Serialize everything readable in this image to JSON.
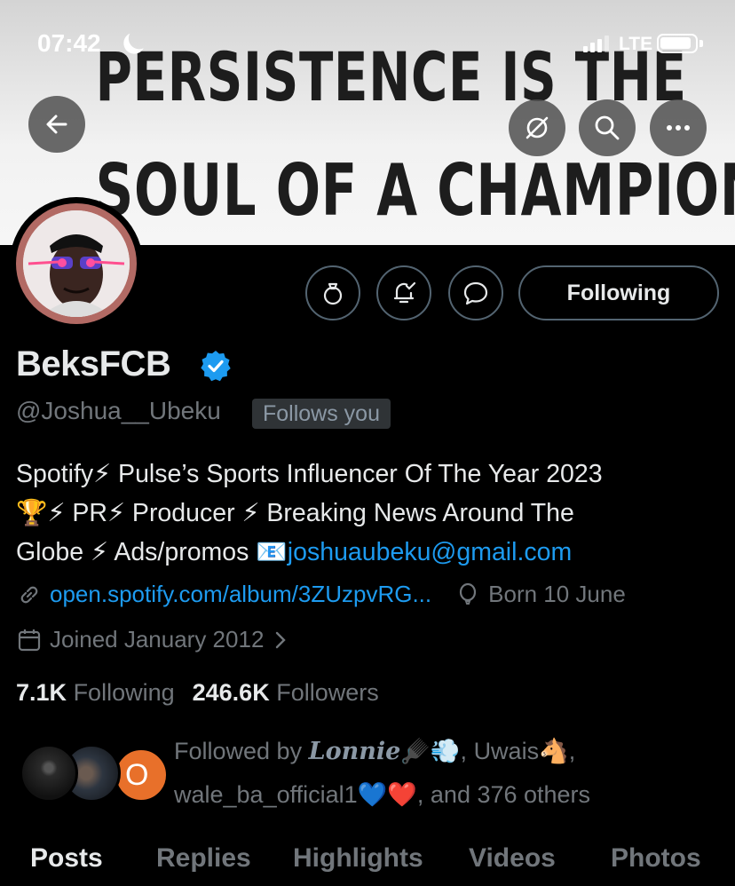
{
  "status_bar": {
    "time": "07:42",
    "network": "LTE"
  },
  "banner": {
    "line1": "PERSISTENCE IS THE",
    "line2": "SOUL OF A CHAMPION"
  },
  "header_icons": [
    "back-arrow-icon",
    "grok-icon",
    "search-icon",
    "more-icon"
  ],
  "actions": {
    "following_label": "Following"
  },
  "profile": {
    "display_name": "BeksFCB",
    "handle": "@Joshua__Ubeku",
    "follows_you": "Follows you",
    "bio_line1": "Spotify⚡ Pulse’s Sports Influencer Of The Year 2023",
    "bio_line2": "🏆⚡ PR⚡ Producer ⚡ Breaking News Around The",
    "bio_line3_text": "Globe ⚡ Ads/promos 📧",
    "bio_email": "joshuaubeku@gmail.com",
    "website": "open.spotify.com/album/3ZUzpvRG...",
    "birthday": "Born 10 June",
    "joined": "Joined January 2012"
  },
  "stats": {
    "following_count": "7.1K",
    "following_label": "Following",
    "followers_count": "246.6K",
    "followers_label": "Followers"
  },
  "followed_by": {
    "prefix": "Followed by",
    "name1": "Lonnie",
    "name1_emoji": "🪮💨",
    "name2": "Uwais🐴",
    "name3": "wale_ba_official1",
    "name3_emoji": "💙❤️",
    "suffix": ", and 376 others",
    "third_avatar_letter": "O"
  },
  "tabs": [
    "Posts",
    "Replies",
    "Highlights",
    "Videos",
    "Photos"
  ],
  "active_tab": "Posts",
  "colors": {
    "accent": "#1d9bf0",
    "verified": "#1d9bf0",
    "muted": "#71767b",
    "background": "#000000"
  }
}
